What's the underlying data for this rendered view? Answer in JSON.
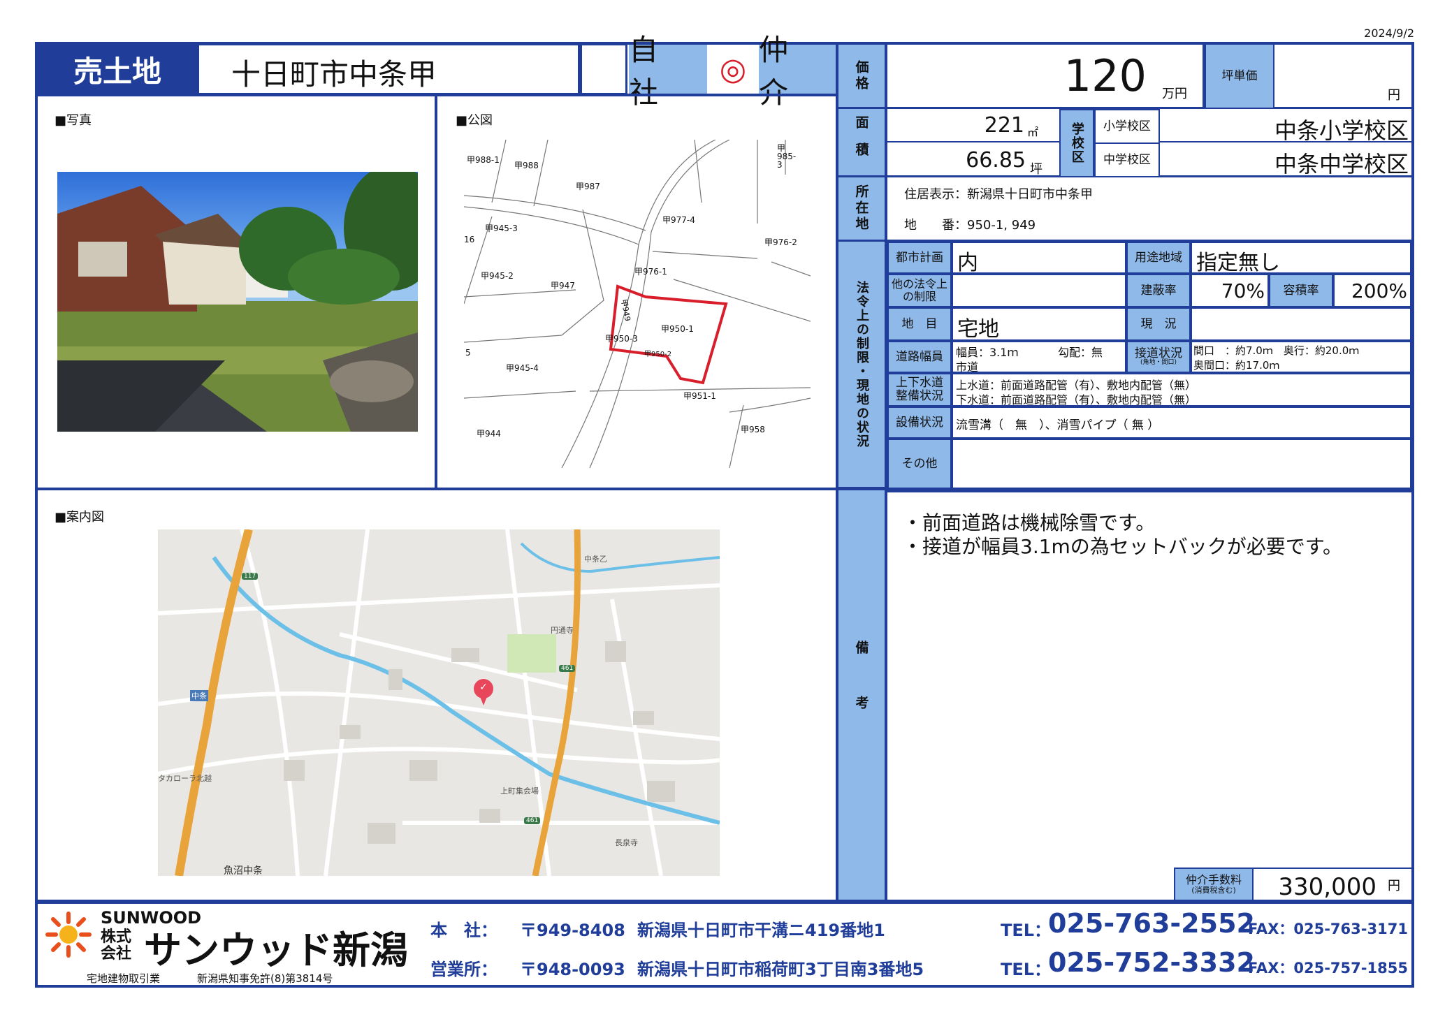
{
  "date": "2024/9/2",
  "header": {
    "type_label": "売土地",
    "title": "十日町市中条甲",
    "own_label": "自社",
    "circle": "◎",
    "broker_label": "仲介"
  },
  "price": {
    "label": "価格",
    "value": "120",
    "unit": "万円",
    "tsubo_label": "坪単価",
    "tsubo_unit": "円"
  },
  "area": {
    "label": "面積",
    "sqm": "221",
    "sqm_unit": "㎡",
    "tsubo": "66.85",
    "tsubo_unit": "坪"
  },
  "school": {
    "label": "学校区",
    "elem_label": "小学校区",
    "elem_value": "中条小学校区",
    "junior_label": "中学校区",
    "junior_value": "中条中学校区"
  },
  "location": {
    "label": "所在地",
    "address": "住居表示：新潟県十日町市中条甲",
    "lot": "地　　番：950-1, 949"
  },
  "legal": {
    "label": "法令上の制限・現地の状況",
    "city_plan_label": "都市計画",
    "city_plan_value": "内",
    "zone_label": "用途地域",
    "zone_value": "指定無し",
    "other_law_label": "他の法令上の制限",
    "coverage_label": "建蔽率",
    "coverage_value": "70%",
    "far_label": "容積率",
    "far_value": "200%",
    "land_cat_label": "地　目",
    "land_cat_value": "宅地",
    "current_label": "現　況",
    "road_label": "道路幅員",
    "road_width": "幅員：3.1ｍ",
    "road_slope": "勾配：無",
    "road_type": "市道",
    "access_label": "接道状況",
    "access_sub": "(角地・間口)",
    "access_line1": "間口　：約7.0ｍ　奥行：約20.0ｍ",
    "access_line2": "奥間口：約17.0ｍ",
    "water_label": "上下水道整備状況",
    "water_line1": "上水道：前面道路配管（有）、敷地内配管（無）",
    "water_line2": "下水道：前面道路配管（有）、敷地内配管（無）",
    "equip_label": "設備状況",
    "equip_value": "流雪溝（　無　）、消雪パイプ（ 無 ）",
    "other_label": "その他"
  },
  "sections": {
    "photo": "■写真",
    "plat": "■公図",
    "guide": "■案内図"
  },
  "plat_labels": [
    "甲988-1",
    "甲988",
    "甲987",
    "甲985-3",
    "甲945-3",
    "甲977-4",
    "甲976-2",
    "16",
    "甲976-1",
    "甲945-2",
    "甲947",
    "甲949",
    "甲950-1",
    "甲950-3",
    "甲950-2",
    "5",
    "甲945-4",
    "甲951-1",
    "甲944",
    "甲958"
  ],
  "map_labels": [
    "中条乙",
    "円通寺",
    "中条",
    "タカローラ北越",
    "上町集会場",
    "長泉寺",
    "魚沼中条",
    "117",
    "461",
    "461"
  ],
  "remarks": {
    "label": "備考",
    "lines": [
      "・前面道路は機械除雪です。",
      "・接道が幅員3.1mの為セットバックが必要です。"
    ]
  },
  "fee": {
    "label": "仲介手数料",
    "sub": "(消費税含む)",
    "value": "330,000",
    "unit": "円"
  },
  "company": {
    "brand": "SUNWOOD",
    "kabu": "株式会社",
    "name": "サンウッド新潟",
    "license_label": "宅地建物取引業",
    "license": "新潟県知事免許(8)第3814号",
    "hq_label": "本　社：",
    "hq_zip": "〒949-8408",
    "hq_addr": "新潟県十日町市干溝ニ419番地1",
    "hq_tel_label": "TEL：",
    "hq_tel": "025-763-2552",
    "hq_fax": "FAX：025-763-3171",
    "br_label": "営業所：",
    "br_zip": "〒948-0093",
    "br_addr": "新潟県十日町市稲荷町3丁目南3番地5",
    "br_tel_label": "TEL：",
    "br_tel": "025-752-3332",
    "br_fax": "FAX：025-757-1855"
  },
  "colors": {
    "accent": "#1f3d99",
    "label_bg": "#8fb9e8",
    "parcel": "#d81e2a",
    "map_road": "#e8a33a",
    "map_river": "#6cc0e8"
  }
}
